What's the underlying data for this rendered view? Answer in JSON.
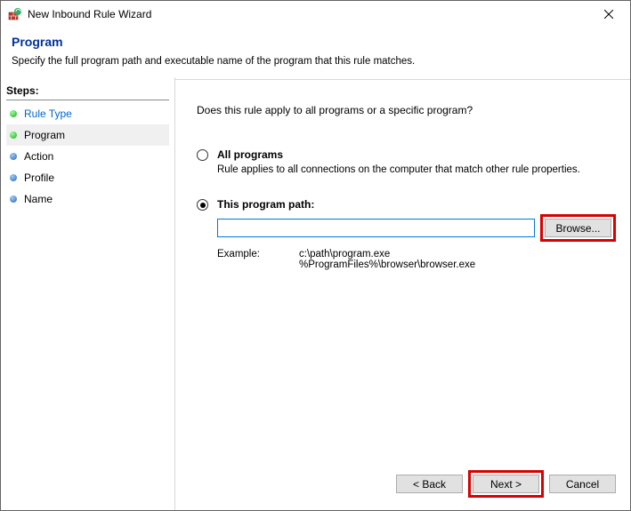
{
  "window": {
    "title": "New Inbound Rule Wizard"
  },
  "header": {
    "page_title": "Program",
    "subtitle": "Specify the full program path and executable name of the program that this rule matches."
  },
  "steps": {
    "title": "Steps:",
    "items": [
      {
        "label": "Rule Type",
        "state": "past"
      },
      {
        "label": "Program",
        "state": "current"
      },
      {
        "label": "Action",
        "state": "future"
      },
      {
        "label": "Profile",
        "state": "future"
      },
      {
        "label": "Name",
        "state": "future"
      }
    ]
  },
  "content": {
    "question": "Does this rule apply to all programs or a specific program?",
    "option_all": {
      "label": "All programs",
      "desc": "Rule applies to all connections on the computer that match other rule properties.",
      "selected": false
    },
    "option_path": {
      "label": "This program path:",
      "selected": true,
      "value": "",
      "browse": "Browse...",
      "example_label": "Example:",
      "example_lines": "c:\\path\\program.exe\n%ProgramFiles%\\browser\\browser.exe"
    }
  },
  "buttons": {
    "back": "< Back",
    "next": "Next >",
    "cancel": "Cancel"
  }
}
